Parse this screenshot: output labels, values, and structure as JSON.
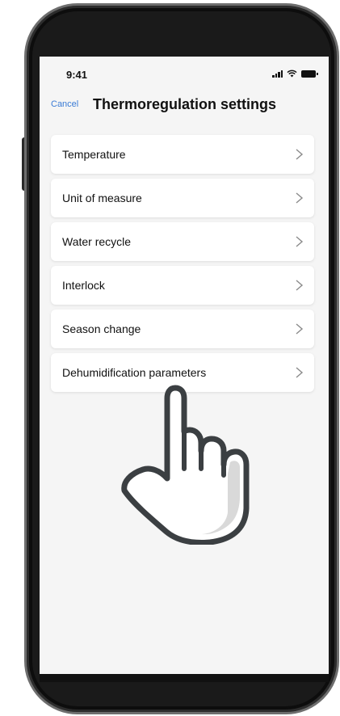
{
  "status_bar": {
    "time": "9:41",
    "icons": [
      "signal-icon",
      "wifi-icon",
      "battery-icon"
    ]
  },
  "nav": {
    "cancel_label": "Cancel",
    "title": "Thermoregulation settings"
  },
  "menu": {
    "items": [
      {
        "label": "Temperature"
      },
      {
        "label": "Unit of measure"
      },
      {
        "label": "Water recycle"
      },
      {
        "label": "Interlock"
      },
      {
        "label": "Season change"
      },
      {
        "label": "Dehumidification parameters"
      }
    ]
  },
  "colors": {
    "accent": "#3a7bd5",
    "screen_background": "#f5f5f5",
    "card_background": "#ffffff"
  },
  "overlay": {
    "icon": "pointing-hand-icon"
  }
}
